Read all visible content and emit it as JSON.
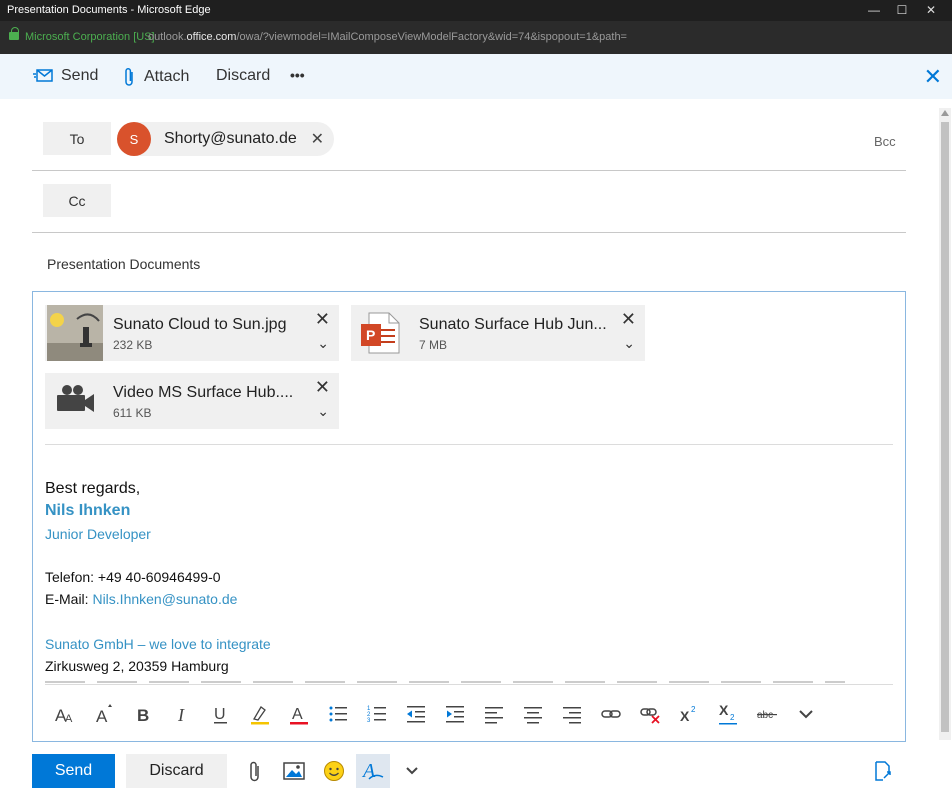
{
  "window": {
    "title": "Presentation Documents - Microsoft Edge",
    "org": "Microsoft Corporation [US]",
    "url_prefix": "outlook.",
    "url_domain": "office.com",
    "url_rest": "/owa/?viewmodel=IMailComposeViewModelFactory&wid=74&ispopout=1&path="
  },
  "toolbar": {
    "send_label": "Send",
    "attach_label": "Attach",
    "discard_label": "Discard",
    "more_label": "•••"
  },
  "recipients": {
    "to_label": "To",
    "cc_label": "Cc",
    "bcc_label": "Bcc",
    "to_avatar_letter": "S",
    "to_email": "Shorty@sunato.de"
  },
  "subject": "Presentation Documents",
  "attachments": [
    {
      "name": "Sunato Cloud to Sun.jpg",
      "size": "232 KB",
      "icon": "image-thumbnail"
    },
    {
      "name": "Sunato Surface Hub Jun...",
      "size": "7 MB",
      "icon": "powerpoint-icon"
    },
    {
      "name": "Video MS Surface Hub....",
      "size": "611 KB",
      "icon": "video-camera-icon"
    }
  ],
  "signature": {
    "greeting": "Best regards,",
    "name": "Nils Ihnken",
    "role": "Junior Developer",
    "phone": "Telefon: +49 40-60946499-0",
    "email_label": "E-Mail: ",
    "email": "Nils.Ihnken@sunato.de",
    "company": "Sunato GmbH – we love to integrate",
    "address": "Zirkusweg 2, 20359 Hamburg"
  },
  "bottom": {
    "send_label": "Send",
    "discard_label": "Discard"
  },
  "colors": {
    "accent": "#0078d7",
    "avatar": "#d9522c",
    "signature_blue": "#3592c4"
  }
}
